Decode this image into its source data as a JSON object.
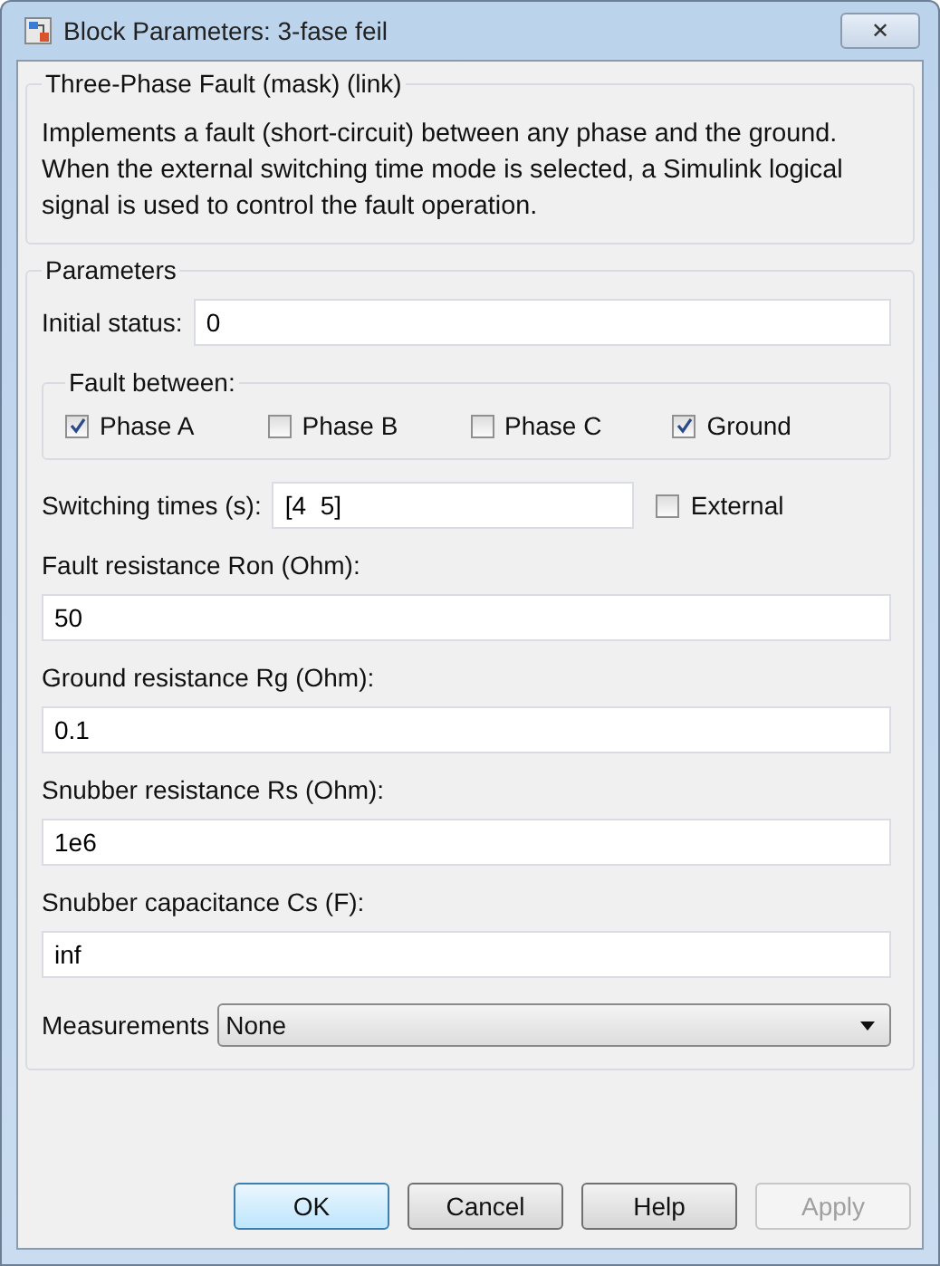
{
  "window": {
    "title": "Block Parameters: 3-fase feil",
    "close": "✕"
  },
  "description": {
    "title": "Three-Phase Fault (mask) (link)",
    "text": "Implements a fault (short-circuit) between any phase and the ground. When the external switching time mode is selected, a Simulink logical signal is used to control the fault operation."
  },
  "parameters": {
    "title": "Parameters",
    "initial_status": {
      "label": "Initial status:",
      "value": "0"
    },
    "fault_between": {
      "title": "Fault between:",
      "options": [
        {
          "label": "Phase A",
          "checked": true
        },
        {
          "label": "Phase B",
          "checked": false
        },
        {
          "label": "Phase C",
          "checked": false
        },
        {
          "label": "Ground",
          "checked": true
        }
      ]
    },
    "switching_times": {
      "label": "Switching times (s):",
      "value": "[4  5]",
      "external": {
        "label": "External",
        "checked": false
      }
    },
    "fields": [
      {
        "label": "Fault resistance Ron (Ohm):",
        "value": "50"
      },
      {
        "label": "Ground resistance Rg (Ohm):",
        "value": "0.1"
      },
      {
        "label": "Snubber resistance Rs (Ohm):",
        "value": "1e6"
      },
      {
        "label": "Snubber capacitance Cs (F):",
        "value": "inf"
      }
    ],
    "measurements": {
      "label": "Measurements",
      "value": "None"
    }
  },
  "buttons": [
    {
      "label": "OK",
      "default": true,
      "disabled": false
    },
    {
      "label": "Cancel",
      "default": false,
      "disabled": false
    },
    {
      "label": "Help",
      "default": false,
      "disabled": false
    },
    {
      "label": "Apply",
      "default": false,
      "disabled": true
    }
  ]
}
